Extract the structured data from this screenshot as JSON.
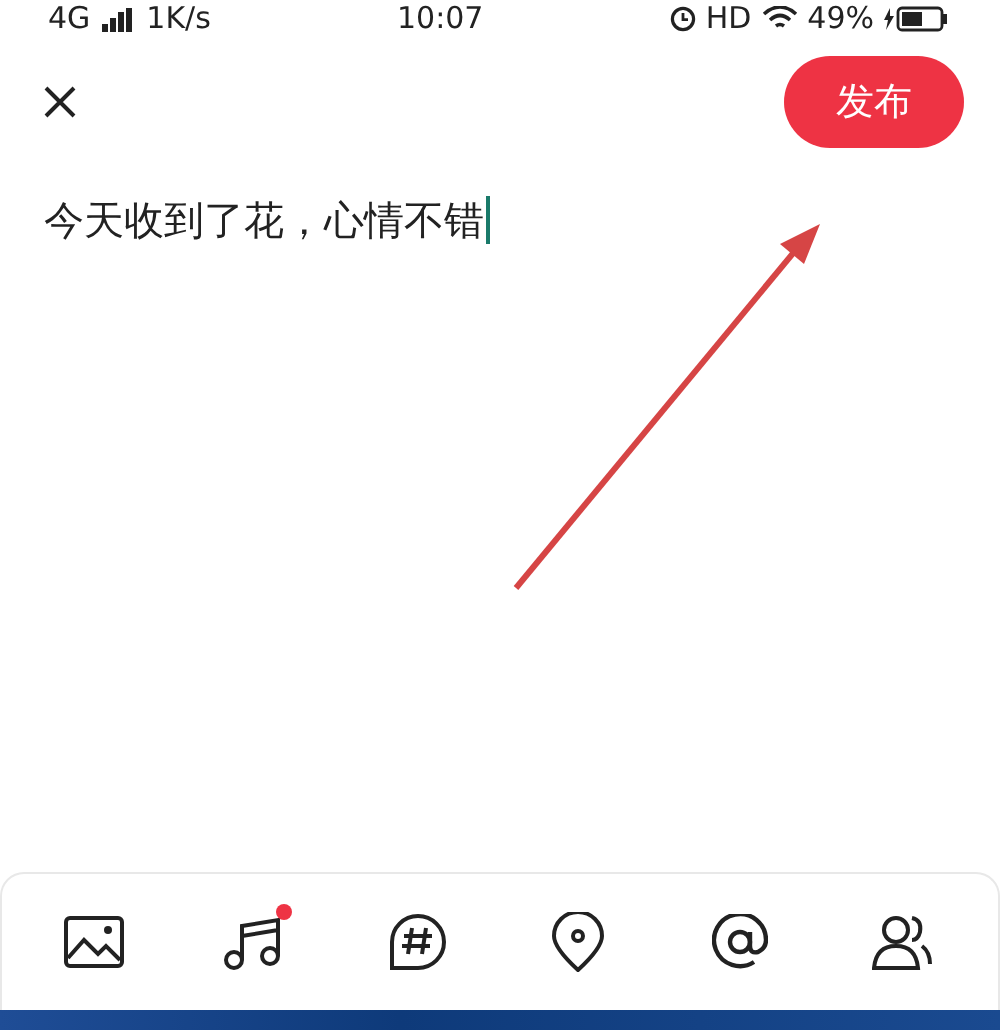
{
  "status_bar": {
    "network": "4G",
    "speed": "1K/s",
    "time": "10:07",
    "hd": "HD",
    "battery": "49%"
  },
  "header": {
    "publish_button": "发布"
  },
  "editor": {
    "value": "今天收到了花，心情不错"
  },
  "toolbar": [
    {
      "kind": "image",
      "badge": false
    },
    {
      "kind": "music",
      "badge": true
    },
    {
      "kind": "topic",
      "badge": false
    },
    {
      "kind": "location",
      "badge": false
    },
    {
      "kind": "mention",
      "badge": false
    },
    {
      "kind": "friends",
      "badge": false
    }
  ]
}
